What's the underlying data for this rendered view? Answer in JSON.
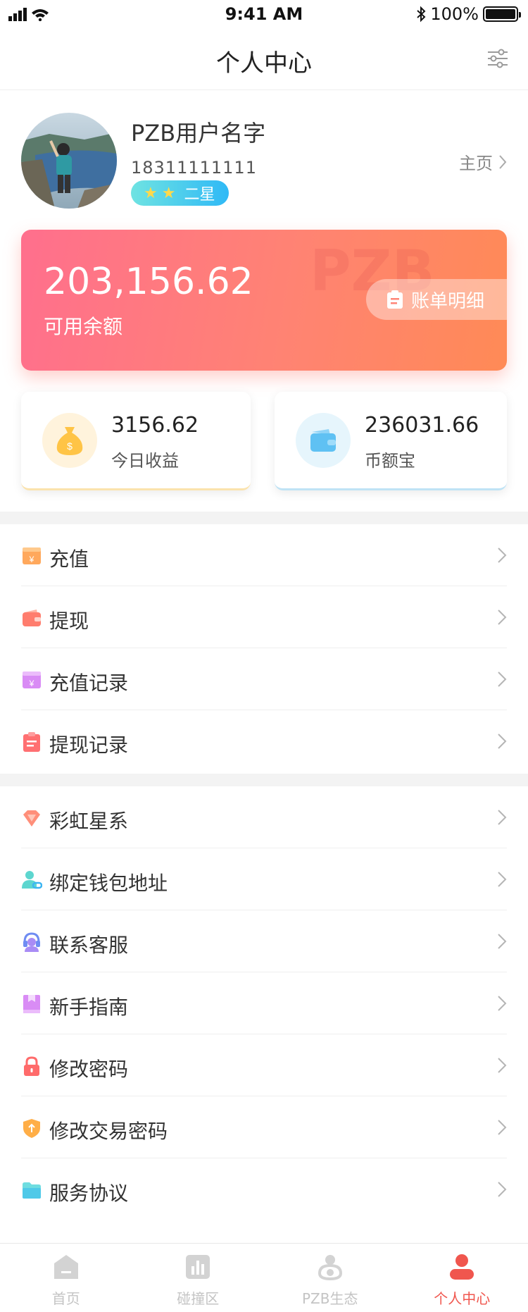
{
  "status_bar": {
    "time": "9:41 AM",
    "battery": "100%"
  },
  "nav": {
    "title": "个人中心",
    "settings_icon": "sliders-icon"
  },
  "profile": {
    "name": "PZB用户名字",
    "phone": "18311111111",
    "level": "二星",
    "stars": 2,
    "home_link": "主页"
  },
  "balance": {
    "amount": "203,156.62",
    "label": "可用余额",
    "watermark": "PZB",
    "detail_button": "账单明细"
  },
  "stats": [
    {
      "value": "3156.62",
      "label": "今日收益",
      "icon": "money-bag-icon"
    },
    {
      "value": "236031.66",
      "label": "币额宝",
      "icon": "wallet-icon"
    }
  ],
  "menu_group_1": [
    {
      "label": "充值",
      "icon": "recharge-icon"
    },
    {
      "label": "提现",
      "icon": "withdraw-wallet-icon"
    },
    {
      "label": "充值记录",
      "icon": "recharge-record-icon"
    },
    {
      "label": "提现记录",
      "icon": "withdraw-record-icon"
    }
  ],
  "menu_group_2": [
    {
      "label": "彩虹星系",
      "icon": "diamond-icon"
    },
    {
      "label": "绑定钱包地址",
      "icon": "user-link-icon"
    },
    {
      "label": "联系客服",
      "icon": "headset-icon"
    },
    {
      "label": "新手指南",
      "icon": "guide-book-icon"
    },
    {
      "label": "修改密码",
      "icon": "lock-icon"
    },
    {
      "label": "修改交易密码",
      "icon": "shield-icon"
    },
    {
      "label": "服务协议",
      "icon": "folder-icon"
    }
  ],
  "tabs": [
    {
      "label": "首页",
      "icon": "home-icon"
    },
    {
      "label": "碰撞区",
      "icon": "bar-chart-icon"
    },
    {
      "label": "PZB生态",
      "icon": "ecosystem-icon"
    },
    {
      "label": "个人中心",
      "icon": "person-icon"
    }
  ],
  "colors": {
    "accent": "#f0564e",
    "card_start": "#ff6f8d",
    "card_end": "#ff8a56",
    "badge": "#2fb9f6"
  }
}
